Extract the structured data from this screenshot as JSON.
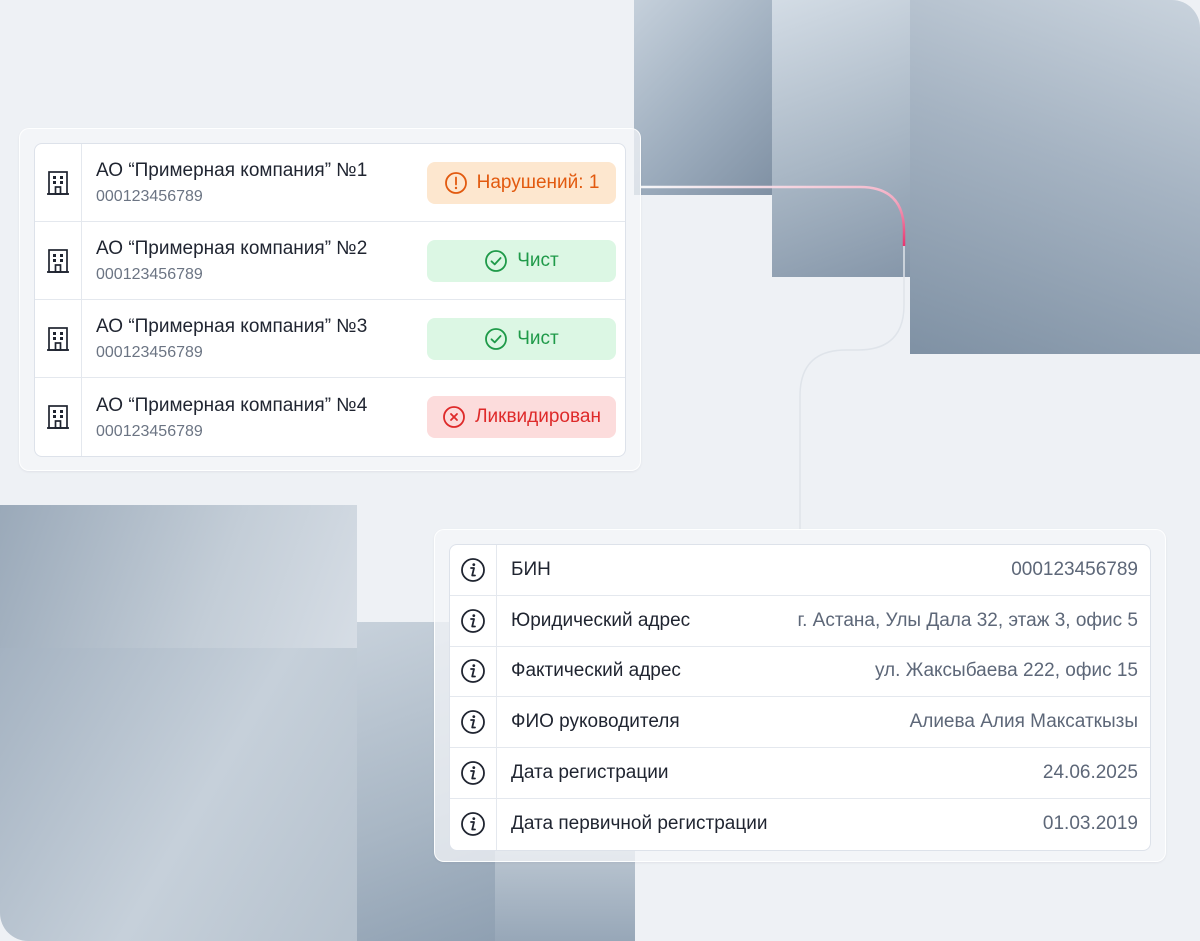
{
  "companies": [
    {
      "name": "АО “Примерная компания” №1",
      "bin": "000123456789",
      "status": "Нарушений: 1",
      "status_type": "warn",
      "icon": "building-icon"
    },
    {
      "name": "АО “Примерная компания” №2",
      "bin": "000123456789",
      "status": "Чист",
      "status_type": "ok",
      "icon": "building-icon"
    },
    {
      "name": "АО “Примерная компания” №3",
      "bin": "000123456789",
      "status": "Чист",
      "status_type": "ok",
      "icon": "building-icon"
    },
    {
      "name": "АО “Примерная компания” №4",
      "bin": "000123456789",
      "status": "Ликвидирован",
      "status_type": "bad",
      "icon": "building-icon"
    }
  ],
  "details": [
    {
      "label": "БИН",
      "value": "000123456789",
      "icon": "info-icon"
    },
    {
      "label": "Юридический адрес",
      "value": "г. Астана, Улы Дала 32, этаж 3, офис 5",
      "icon": "info-icon"
    },
    {
      "label": "Фактический адрес",
      "value": "ул. Жаксыбаева 222, офис 15",
      "icon": "info-icon"
    },
    {
      "label": "ФИО руководителя",
      "value": "Алиева Алия Максаткызы",
      "icon": "info-icon"
    },
    {
      "label": "Дата регистрации",
      "value": "24.06.2025",
      "icon": "info-icon"
    },
    {
      "label": "Дата первичной регистрации",
      "value": "01.03.2019",
      "icon": "info-icon"
    }
  ],
  "colors": {
    "warn_bg": "#fde7cf",
    "warn_fg": "#e25a0f",
    "ok_bg": "#dcf7e4",
    "ok_fg": "#1f9a49",
    "bad_bg": "#fcdcdc",
    "bad_fg": "#de2a2a",
    "connector_accent": "#e8336e"
  }
}
